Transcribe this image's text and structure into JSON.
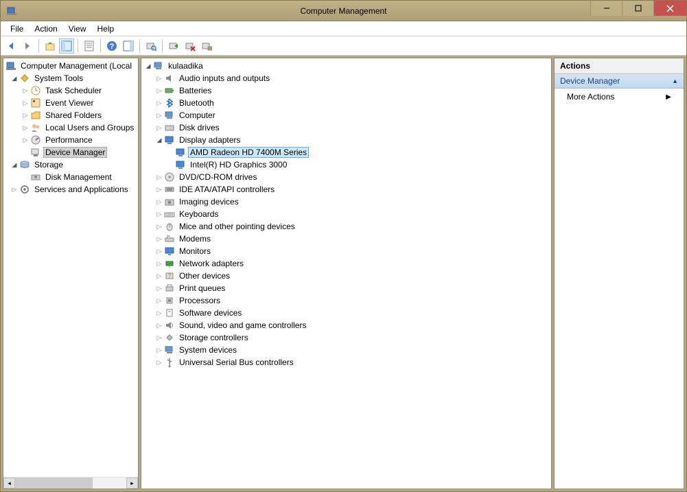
{
  "window": {
    "title": "Computer Management"
  },
  "menubar": {
    "items": [
      "File",
      "Action",
      "View",
      "Help"
    ]
  },
  "leftTree": {
    "root": "Computer Management (Local",
    "systemTools": "System Tools",
    "taskScheduler": "Task Scheduler",
    "eventViewer": "Event Viewer",
    "sharedFolders": "Shared Folders",
    "localUsers": "Local Users and Groups",
    "performance": "Performance",
    "deviceManager": "Device Manager",
    "storage": "Storage",
    "diskManagement": "Disk Management",
    "servicesApps": "Services and Applications"
  },
  "centerTree": {
    "root": "kulaadika",
    "audio": "Audio inputs and outputs",
    "batteries": "Batteries",
    "bluetooth": "Bluetooth",
    "computer": "Computer",
    "diskDrives": "Disk drives",
    "displayAdapters": "Display adapters",
    "displayChild1": "AMD Radeon HD 7400M Series",
    "displayChild2": "Intel(R) HD Graphics 3000",
    "dvd": "DVD/CD-ROM drives",
    "ide": "IDE ATA/ATAPI controllers",
    "imaging": "Imaging devices",
    "keyboards": "Keyboards",
    "mice": "Mice and other pointing devices",
    "modems": "Modems",
    "monitors": "Monitors",
    "network": "Network adapters",
    "other": "Other devices",
    "printQueues": "Print queues",
    "processors": "Processors",
    "software": "Software devices",
    "sound": "Sound, video and game controllers",
    "storageCtl": "Storage controllers",
    "system": "System devices",
    "usb": "Universal Serial Bus controllers"
  },
  "actions": {
    "header": "Actions",
    "section": "Device Manager",
    "moreActions": "More Actions"
  }
}
